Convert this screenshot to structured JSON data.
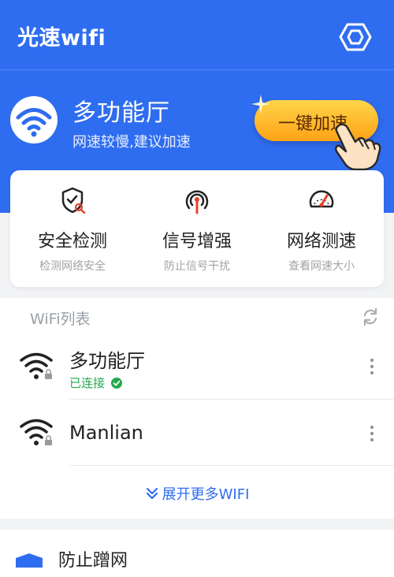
{
  "app": {
    "title": "光速wifi"
  },
  "colors": {
    "primary": "#2f6df0",
    "boost_button": "#ffb41f",
    "connected": "#25a84b"
  },
  "hero": {
    "title": "多功能厅",
    "subtitle": "网速较慢,建议加速",
    "boost_label": "一键加速"
  },
  "features": [
    {
      "title": "安全检测",
      "subtitle": "检测网络安全",
      "icon": "shield-check-icon"
    },
    {
      "title": "信号增强",
      "subtitle": "防止信号干扰",
      "icon": "signal-tower-icon"
    },
    {
      "title": "网络测速",
      "subtitle": "查看网速大小",
      "icon": "speedometer-icon"
    }
  ],
  "wifi_list": {
    "header": "WiFi列表",
    "networks": [
      {
        "name": "多功能厅",
        "status": "已连接",
        "connected": true,
        "locked": true
      },
      {
        "name": "Manlian",
        "status": "",
        "connected": false,
        "locked": true
      }
    ],
    "expand_label": "展开更多WIFI"
  },
  "bottom_card": {
    "title": "防止蹭网"
  }
}
